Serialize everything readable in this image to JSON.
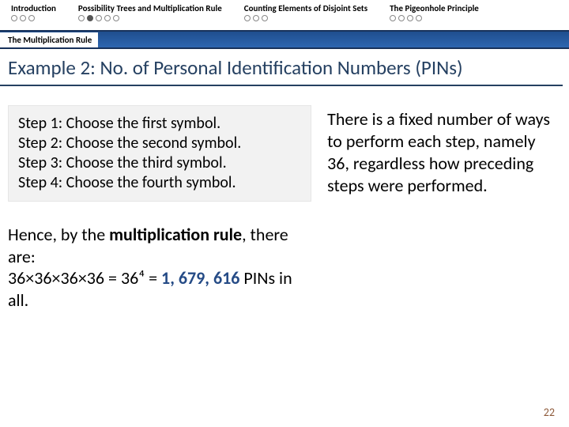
{
  "nav": {
    "sections": [
      {
        "label": "Introduction",
        "dots": 3,
        "current": -1
      },
      {
        "label": "Possibility Trees and Multiplication Rule",
        "dots": 5,
        "current": 1
      },
      {
        "label": "Counting Elements of Disjoint Sets",
        "dots": 3,
        "current": -1
      },
      {
        "label": "The Pigeonhole Principle",
        "dots": 4,
        "current": -1
      }
    ],
    "subsection": "The Multiplication Rule"
  },
  "title": "Example 2: No. of Personal Identification Numbers (PINs)",
  "steps": [
    "Step 1: Choose the first symbol.",
    "Step 2: Choose the second symbol.",
    "Step 3: Choose the third symbol.",
    "Step 4: Choose the fourth symbol."
  ],
  "conclusion": {
    "lead": "Hence, by the ",
    "bold": "multiplication rule",
    "tail1": ", there are:",
    "equation_lhs": "36×36×36×36 = 36⁴ = ",
    "equation_ans": "1, 679, 616",
    "tail2": " PINs in all."
  },
  "explanation": "There is a fixed number of ways to perform each step, namely 36, regardless how preceding steps were performed.",
  "page_number": "22"
}
